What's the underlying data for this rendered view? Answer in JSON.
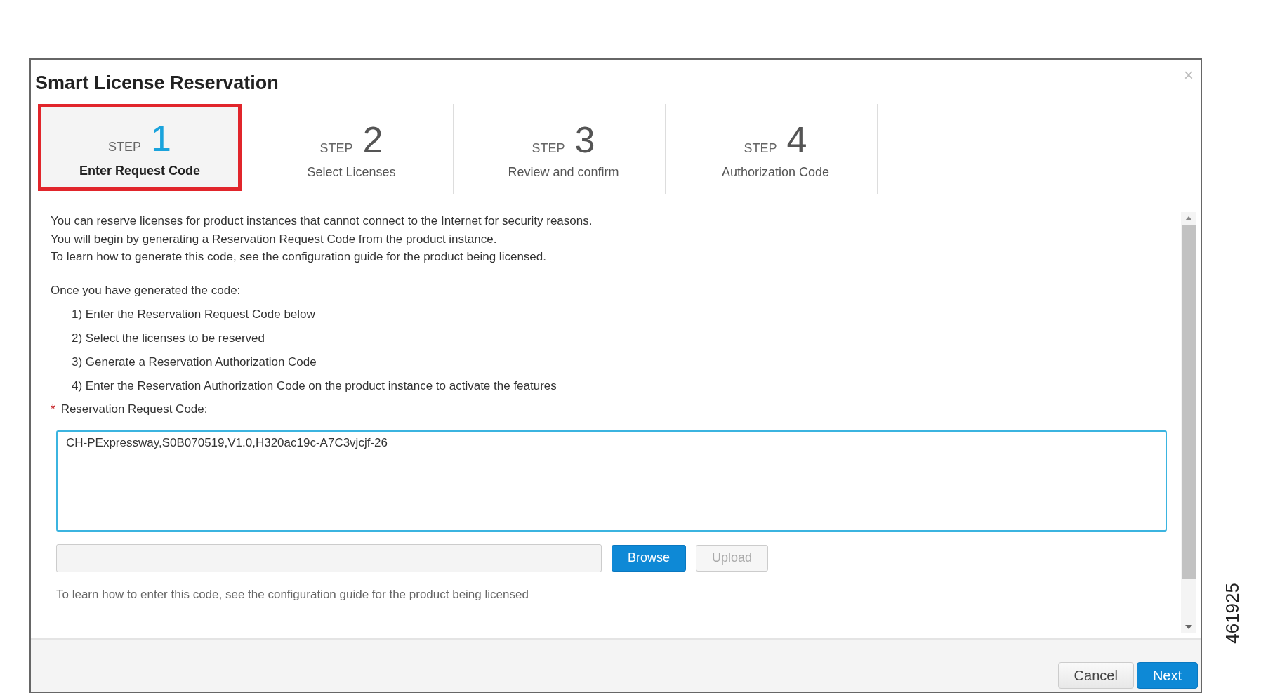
{
  "dialog": {
    "title": "Smart License Reservation",
    "close": "×"
  },
  "steps": [
    {
      "prefix": "STEP",
      "number": "1",
      "label": "Enter Request Code",
      "selected": true
    },
    {
      "prefix": "STEP",
      "number": "2",
      "label": "Select Licenses",
      "selected": false
    },
    {
      "prefix": "STEP",
      "number": "3",
      "label": "Review and confirm",
      "selected": false
    },
    {
      "prefix": "STEP",
      "number": "4",
      "label": "Authorization Code",
      "selected": false
    }
  ],
  "intro": [
    "You can reserve licenses for product instances that cannot connect to the Internet for security reasons.",
    "You will begin by generating a Reservation Request Code from the product instance.",
    "To learn how to generate this code, see the configuration guide for the product being licensed."
  ],
  "instructions_heading": "Once you have generated the code:",
  "instructions": [
    "1) Enter the Reservation Request Code below",
    "2) Select the licenses to be reserved",
    "3) Generate a Reservation Authorization Code",
    "4) Enter the Reservation Authorization Code on the product instance to activate the features"
  ],
  "request_code": {
    "required_mark": "*",
    "label": "Reservation Request Code:",
    "value": "CH-PExpressway,S0B070519,V1.0,H320ac19c-A7C3vjcjf-26"
  },
  "file_upload": {
    "browse": "Browse",
    "upload": "Upload",
    "upload_disabled": true
  },
  "help_text": "To learn how to enter this code, see the configuration guide for the product being licensed",
  "footer": {
    "buttons": [
      "Cancel",
      "Next"
    ]
  },
  "figure_number": "461925"
}
